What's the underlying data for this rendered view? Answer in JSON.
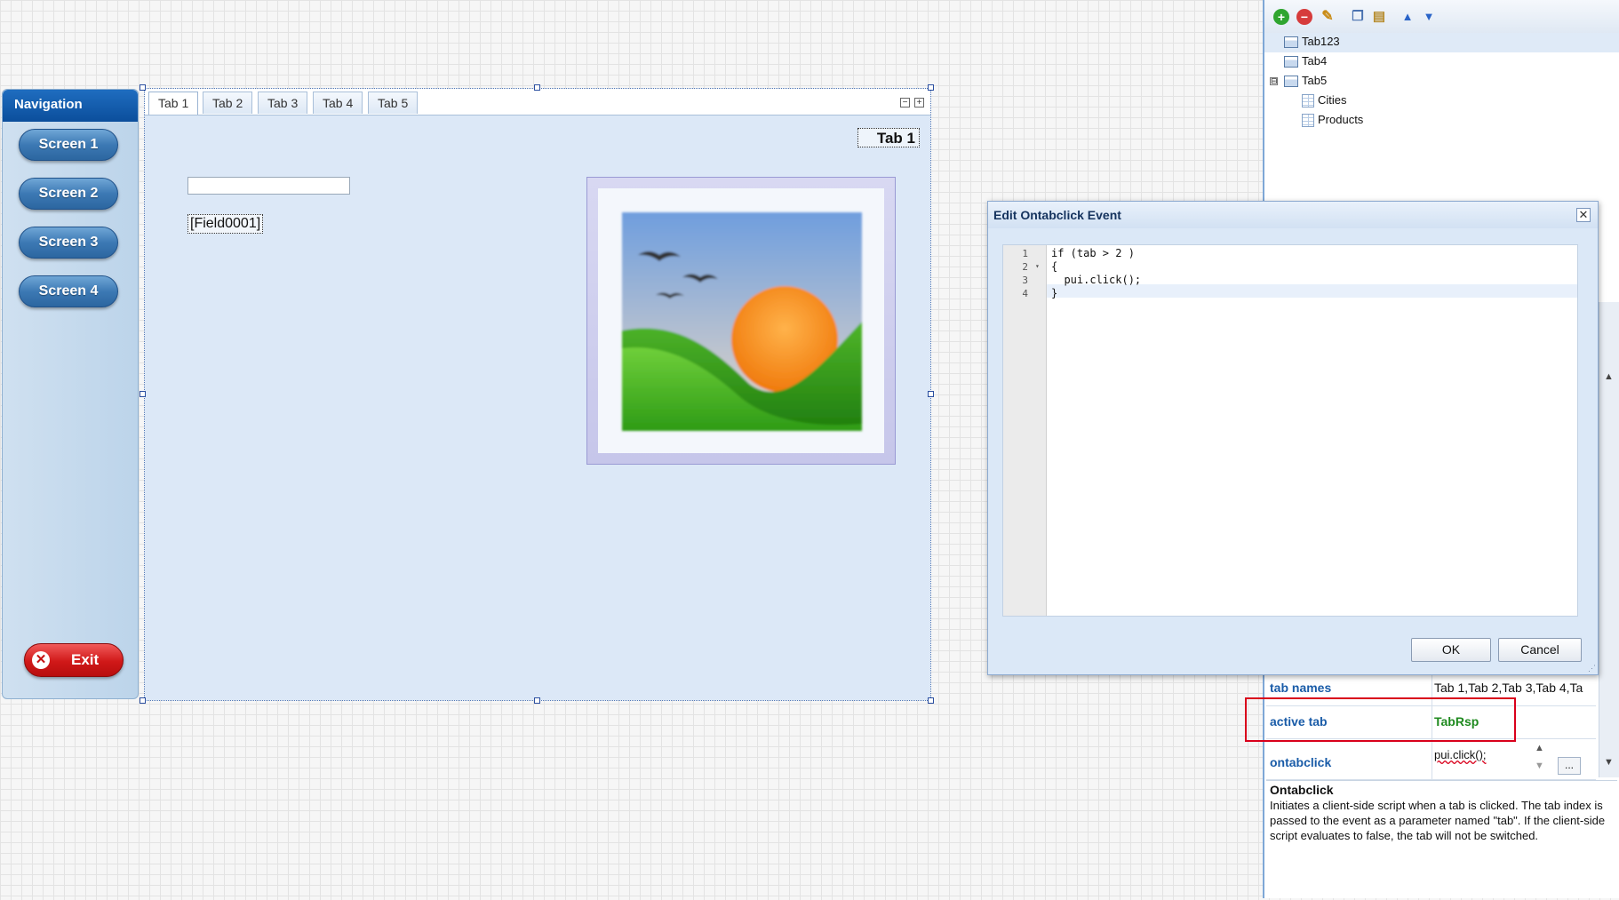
{
  "navigation": {
    "title": "Navigation",
    "buttons": [
      "Screen 1",
      "Screen 2",
      "Screen 3",
      "Screen 4"
    ],
    "exit_label": "Exit"
  },
  "tabpanel": {
    "tabs": [
      "Tab 1",
      "Tab 2",
      "Tab 3",
      "Tab 4",
      "Tab 5"
    ],
    "active_tab": "Tab 1",
    "tab_label": "Tab 1",
    "field_label": "[Field0001]"
  },
  "tree": {
    "items": [
      "Tab123",
      "Tab4",
      "Tab5",
      "Cities",
      "Products"
    ],
    "expander": "⊟"
  },
  "dialog": {
    "title": "Edit Ontabclick Event",
    "close": "✕",
    "line_numbers": [
      "1",
      "2",
      "3",
      "4"
    ],
    "code_lines": [
      "if (tab > 2 )",
      "{",
      "  pui.click();",
      "}"
    ],
    "ok_label": "OK",
    "cancel_label": "Cancel"
  },
  "properties": {
    "rows": [
      {
        "name": "tab names",
        "value": "Tab 1,Tab 2,Tab 3,Tab 4,Ta"
      },
      {
        "name": "active tab",
        "value": "TabRsp"
      },
      {
        "name": "ontabclick",
        "value": "pui.click();"
      }
    ],
    "ellipsis": "...",
    "value_colors": {
      "active_tab": "#1f8a1f",
      "highlight": "#d9001b"
    }
  },
  "description": {
    "title": "Ontabclick",
    "text": "Initiates a client-side script when a tab is clicked. The tab index is passed to the event as a parameter named \"tab\". If the client-side script evaluates to false, the tab will not be switched."
  },
  "icons": {
    "add": "plus-circle-icon",
    "remove": "minus-circle-icon",
    "edit": "pencil-icon",
    "copy": "copy-icon",
    "paste": "paste-icon",
    "up": "arrow-up-icon",
    "down": "arrow-down-icon"
  }
}
